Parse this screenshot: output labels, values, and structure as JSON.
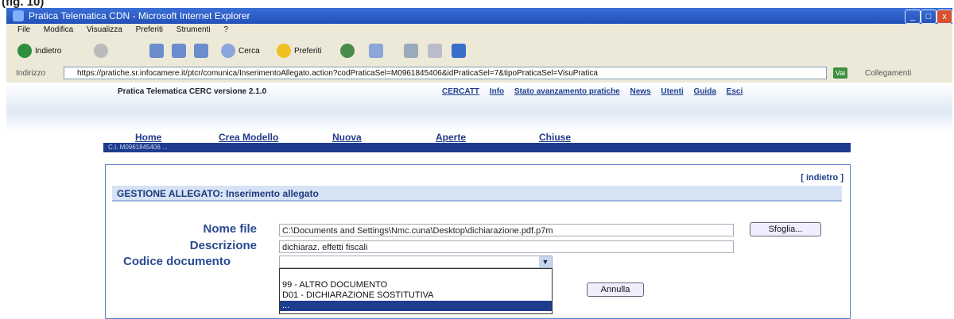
{
  "figure_label": "(fig. 10)",
  "window": {
    "title": "Pratica Telematica CDN - Microsoft Internet Explorer",
    "controls": [
      "_",
      "□",
      "x"
    ]
  },
  "menu": [
    "File",
    "Modifica",
    "Visualizza",
    "Preferiti",
    "Strumenti",
    "?"
  ],
  "toolbar": {
    "back_label": "Indietro",
    "search_label": "Cerca",
    "favorites_label": "Preferiti"
  },
  "address": {
    "label": "Indirizzo",
    "url": "https://pratiche.sr.infocamere.it/ptcr/comunica/InserimentoAllegato.action?codPraticaSel=M0961845406&idPraticaSel=7&tipoPraticaSel=VisuPratica",
    "go_label": "Vai",
    "links_label": "Collegamenti"
  },
  "site": {
    "name": "Pratica Telematica CERC versione 2.1.0",
    "top_links": [
      "CERCATT",
      "Info",
      "Stato avanzamento pratiche",
      "News",
      "Utenti",
      "Guida",
      "Esci"
    ]
  },
  "nav": [
    "Home",
    "Crea Modello",
    "Nuova",
    "Aperte",
    "Chiuse"
  ],
  "navbar_text": "C.I. M0961845406 ...",
  "form": {
    "back_link": "[ indietro ]",
    "section_title": "GESTIONE ALLEGATO: Inserimento allegato",
    "nome_file_label": "Nome file",
    "nome_file_value": "C:\\Documents and Settings\\Nmc.cuna\\Desktop\\dichiarazione.pdf.p7m",
    "browse_label": "Sfoglia...",
    "descrizione_label": "Descrizione",
    "descrizione_value": "dichiaraz. effetti fiscali",
    "codice_label": "Codice documento",
    "codice_value": "",
    "options": [
      "99 - ALTRO DOCUMENTO",
      "D01 - DICHIARAZIONE SOSTITUTIVA",
      "..."
    ],
    "annulla_label": "Annulla"
  }
}
